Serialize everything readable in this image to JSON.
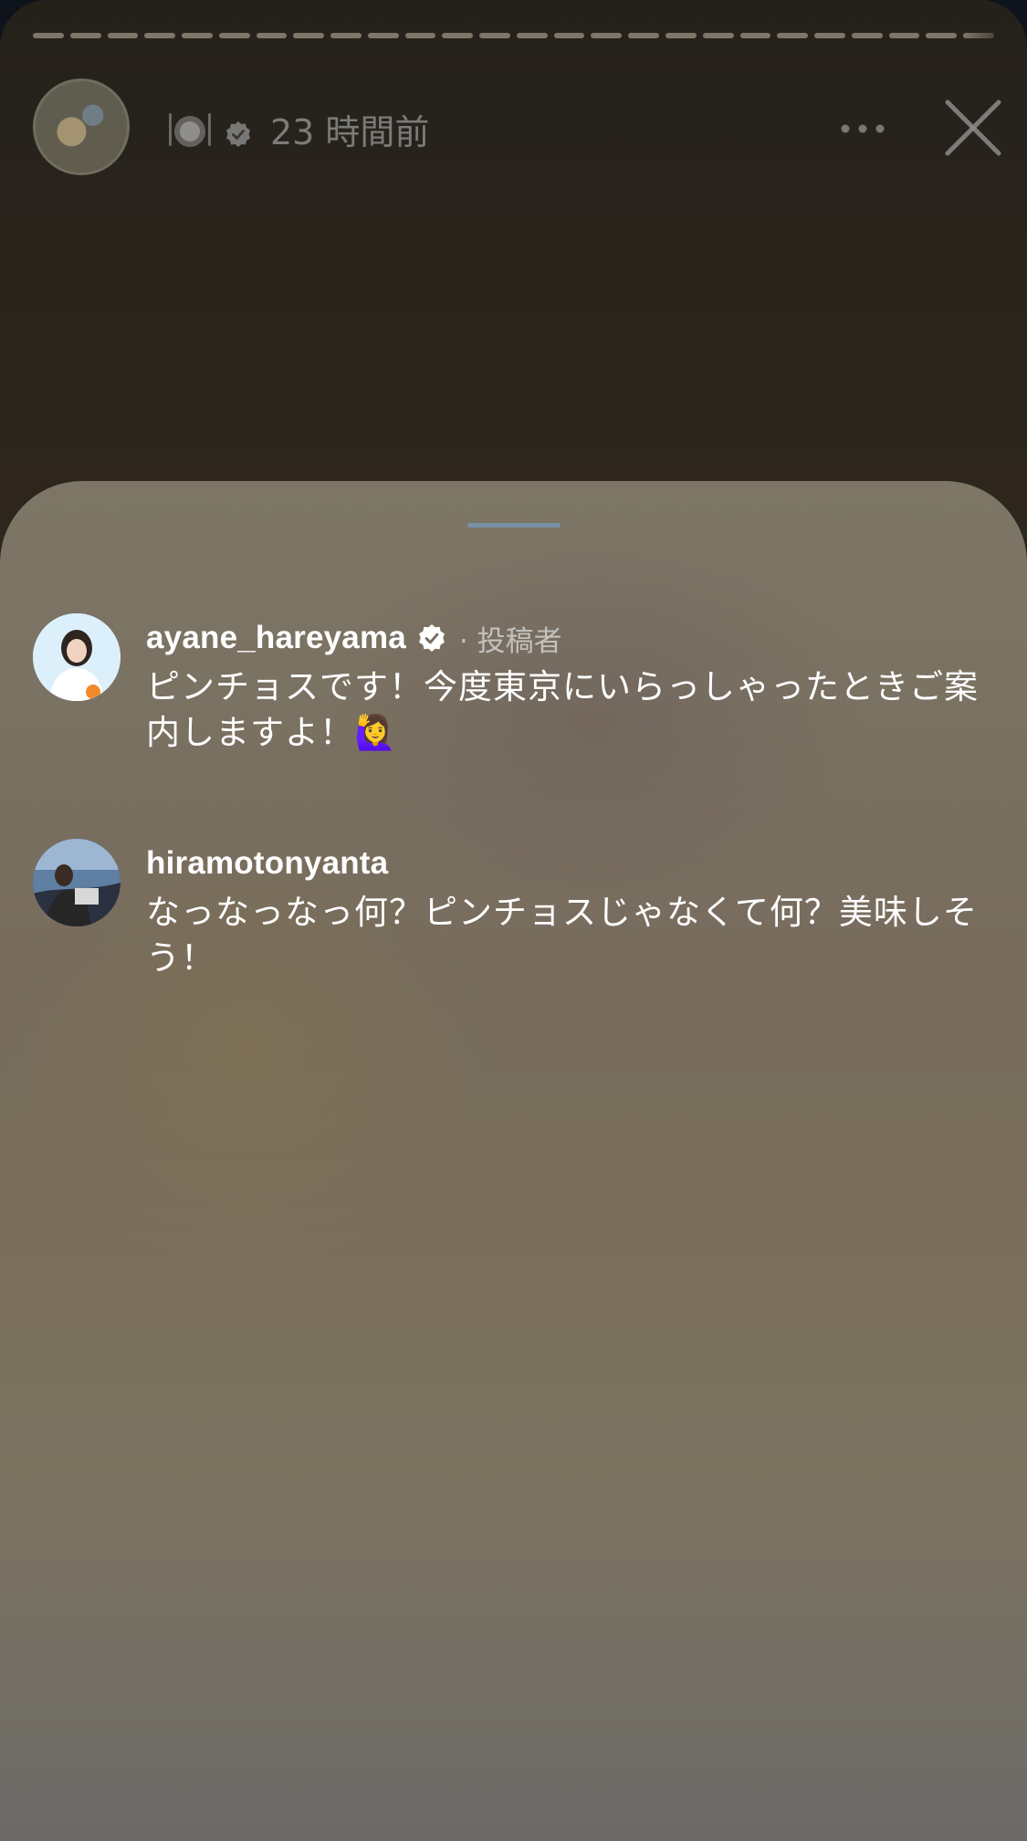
{
  "story": {
    "progress_segments": 26,
    "time_ago": "23 時間前",
    "username_emoji": "🍽️",
    "icons": {
      "verified": "verified-badge-icon",
      "more": "more-options-icon",
      "close": "close-icon"
    }
  },
  "comments": [
    {
      "username": "ayane_hareyama",
      "verified": true,
      "author_tag": "· 投稿者",
      "text": "ピンチョスです！今度東京にいらっしゃったときご案内しますよ！🙋‍♀️"
    },
    {
      "username": "hiramotonyanta",
      "verified": false,
      "author_tag": "",
      "text": "なっなっなっ何？ピンチョスじゃなくて何？美味しそう！"
    }
  ],
  "colors": {
    "sheet_top": "#7d7666",
    "sheet_bottom": "#6b6a68",
    "grab_handle": "#7791a6"
  }
}
